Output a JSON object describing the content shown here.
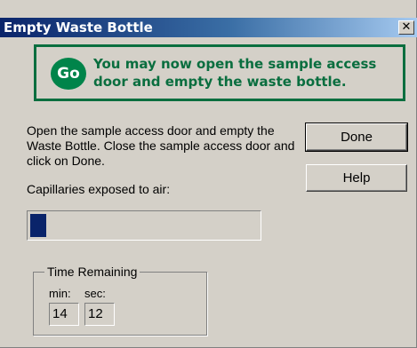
{
  "window": {
    "title": "Empty Waste Bottle",
    "close_glyph": "✕"
  },
  "banner": {
    "badge_text": "Go",
    "message": "You may now open the sample access door and empty the waste bottle.",
    "color": "#0a6e3f"
  },
  "instructions": "Open the sample access door and empty the Waste Bottle. Close the sample access door and click on Done.",
  "buttons": {
    "done_label": "Done",
    "help_label": "Help"
  },
  "capillaries": {
    "label": "Capillaries exposed to air:",
    "progress_fraction": 0.07,
    "fill_color": "#0a246a"
  },
  "time_remaining": {
    "legend": "Time Remaining",
    "min_label": "min:",
    "sec_label": "sec:",
    "min_value": "14",
    "sec_value": "12"
  }
}
